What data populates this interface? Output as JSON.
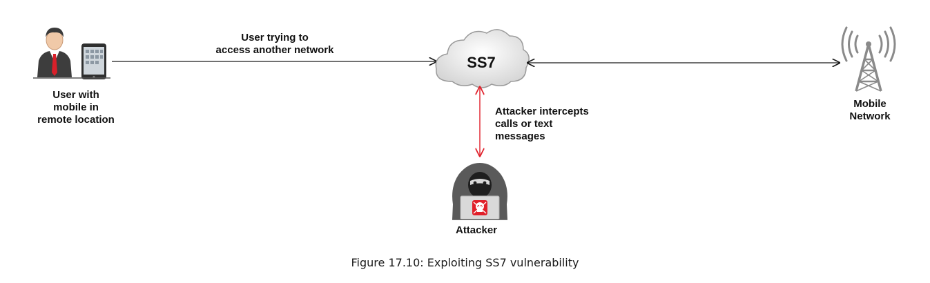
{
  "diagram": {
    "cloud_label": "SS7",
    "user_label": "User with\nmobile in\nremote location",
    "arrow_label": "User trying to\naccess another network",
    "intercept_label": "Attacker intercepts\ncalls or text\nmessages",
    "attacker_label": "Attacker",
    "network_label": "Mobile\nNetwork"
  },
  "caption": "Figure 17.10: Exploiting SS7 vulnerability",
  "colors": {
    "arrow_black": "#1a1a1a",
    "arrow_red": "#e0202a",
    "cloud_fill": "#e8e8e8",
    "cloud_stroke": "#9a9a9a",
    "tower": "#8a8a8a",
    "suit": "#3d3d3d",
    "tie": "#d8202a",
    "hood": "#5a5a5a",
    "skull_bg": "#e0202a"
  },
  "icons": [
    "user-with-tablet-icon",
    "cloud-icon",
    "radio-tower-icon",
    "hooded-attacker-icon",
    "skull-icon"
  ]
}
